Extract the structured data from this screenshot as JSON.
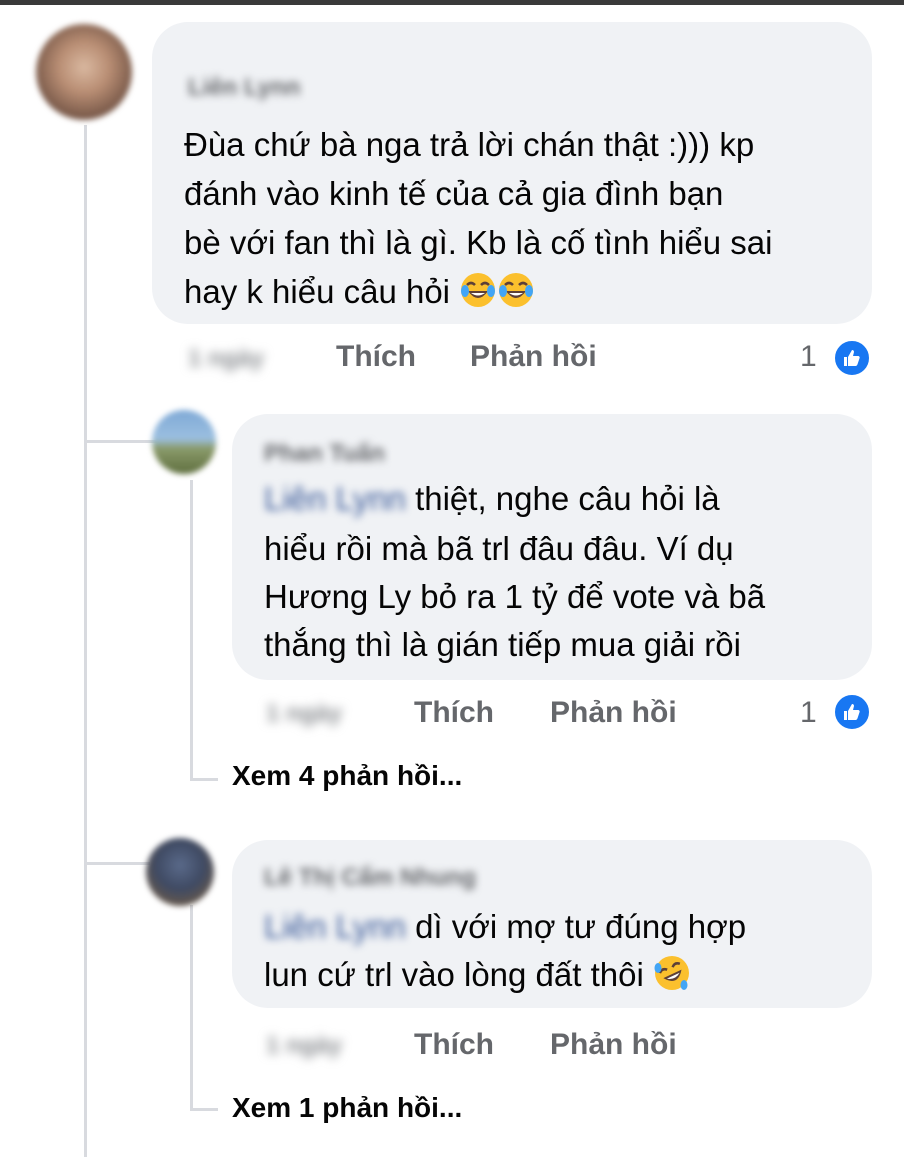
{
  "comments": [
    {
      "author": "Liên Lynn",
      "text_lines": [
        "Đùa chứ bà nga trả lời chán thật :))) kp",
        "đánh vào kinh tế của cả gia đình bạn",
        "bè với fan thì là gì. Kb là cố tình hiểu sai",
        "hay k hiểu câu hỏi"
      ],
      "emoji_icons": [
        "tears-of-joy-emoji",
        "tears-of-joy-emoji"
      ],
      "time": "1 ngày",
      "like_label": "Thích",
      "reply_label": "Phản hồi",
      "reaction_count": "1"
    },
    {
      "author": "Phan Tuấn",
      "mention": "Liên Lynn",
      "text_lines": [
        "thiệt, nghe câu hỏi là",
        "hiểu rồi mà bã trl đâu đâu. Ví dụ",
        "Hương Ly bỏ ra 1 tỷ để vote và bã",
        "thắng thì là gián tiếp mua giải rồi"
      ],
      "time": "1 ngày",
      "like_label": "Thích",
      "reply_label": "Phản hồi",
      "reaction_count": "1",
      "more_replies": "Xem 4 phản hồi..."
    },
    {
      "author": "Lê Thị Cẩm Nhung",
      "mention": "Liên Lynn",
      "text_lines": [
        "dì với mợ tư đúng hợp",
        "lun cứ trl vào lòng đất thôi"
      ],
      "emoji_icons": [
        "rolling-laughing-emoji"
      ],
      "time": "1 ngày",
      "like_label": "Thích",
      "reply_label": "Phản hồi",
      "more_replies": "Xem 1 phản hồi..."
    }
  ],
  "colors": {
    "bubble": "#f0f2f5",
    "action_text": "#65676b",
    "like_blue": "#1877f2",
    "thread_line": "#d8dadf"
  }
}
